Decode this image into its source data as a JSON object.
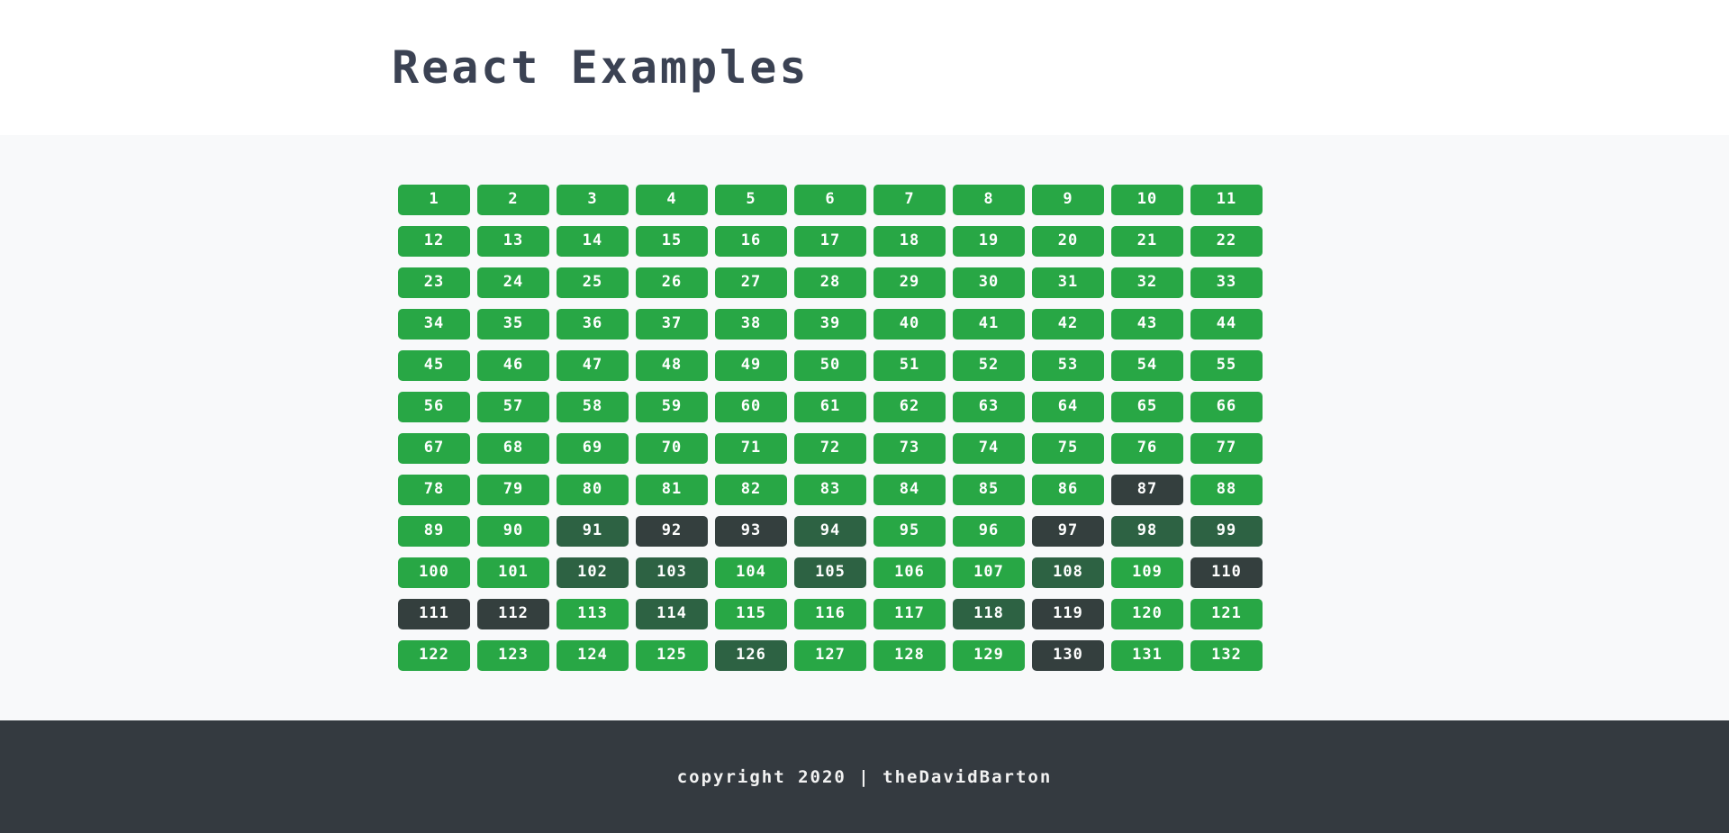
{
  "header": {
    "title": "React Examples"
  },
  "main": {
    "grid": {
      "columns": 11,
      "rows": 12,
      "total_cells": 132,
      "colors": {
        "on": "#28a745",
        "dim": "#2d6243",
        "off": "#343f3e",
        "label": "#ffffff"
      },
      "cells": [
        {
          "label": "1",
          "state": "on"
        },
        {
          "label": "2",
          "state": "on"
        },
        {
          "label": "3",
          "state": "on"
        },
        {
          "label": "4",
          "state": "on"
        },
        {
          "label": "5",
          "state": "on"
        },
        {
          "label": "6",
          "state": "on"
        },
        {
          "label": "7",
          "state": "on"
        },
        {
          "label": "8",
          "state": "on"
        },
        {
          "label": "9",
          "state": "on"
        },
        {
          "label": "10",
          "state": "on"
        },
        {
          "label": "11",
          "state": "on"
        },
        {
          "label": "12",
          "state": "on"
        },
        {
          "label": "13",
          "state": "on"
        },
        {
          "label": "14",
          "state": "on"
        },
        {
          "label": "15",
          "state": "on"
        },
        {
          "label": "16",
          "state": "on"
        },
        {
          "label": "17",
          "state": "on"
        },
        {
          "label": "18",
          "state": "on"
        },
        {
          "label": "19",
          "state": "on"
        },
        {
          "label": "20",
          "state": "on"
        },
        {
          "label": "21",
          "state": "on"
        },
        {
          "label": "22",
          "state": "on"
        },
        {
          "label": "23",
          "state": "on"
        },
        {
          "label": "24",
          "state": "on"
        },
        {
          "label": "25",
          "state": "on"
        },
        {
          "label": "26",
          "state": "on"
        },
        {
          "label": "27",
          "state": "on"
        },
        {
          "label": "28",
          "state": "on"
        },
        {
          "label": "29",
          "state": "on"
        },
        {
          "label": "30",
          "state": "on"
        },
        {
          "label": "31",
          "state": "on"
        },
        {
          "label": "32",
          "state": "on"
        },
        {
          "label": "33",
          "state": "on"
        },
        {
          "label": "34",
          "state": "on"
        },
        {
          "label": "35",
          "state": "on"
        },
        {
          "label": "36",
          "state": "on"
        },
        {
          "label": "37",
          "state": "on"
        },
        {
          "label": "38",
          "state": "on"
        },
        {
          "label": "39",
          "state": "on"
        },
        {
          "label": "40",
          "state": "on"
        },
        {
          "label": "41",
          "state": "on"
        },
        {
          "label": "42",
          "state": "on"
        },
        {
          "label": "43",
          "state": "on"
        },
        {
          "label": "44",
          "state": "on"
        },
        {
          "label": "45",
          "state": "on"
        },
        {
          "label": "46",
          "state": "on"
        },
        {
          "label": "47",
          "state": "on"
        },
        {
          "label": "48",
          "state": "on"
        },
        {
          "label": "49",
          "state": "on"
        },
        {
          "label": "50",
          "state": "on"
        },
        {
          "label": "51",
          "state": "on"
        },
        {
          "label": "52",
          "state": "on"
        },
        {
          "label": "53",
          "state": "on"
        },
        {
          "label": "54",
          "state": "on"
        },
        {
          "label": "55",
          "state": "on"
        },
        {
          "label": "56",
          "state": "on"
        },
        {
          "label": "57",
          "state": "on"
        },
        {
          "label": "58",
          "state": "on"
        },
        {
          "label": "59",
          "state": "on"
        },
        {
          "label": "60",
          "state": "on"
        },
        {
          "label": "61",
          "state": "on"
        },
        {
          "label": "62",
          "state": "on"
        },
        {
          "label": "63",
          "state": "on"
        },
        {
          "label": "64",
          "state": "on"
        },
        {
          "label": "65",
          "state": "on"
        },
        {
          "label": "66",
          "state": "on"
        },
        {
          "label": "67",
          "state": "on"
        },
        {
          "label": "68",
          "state": "on"
        },
        {
          "label": "69",
          "state": "on"
        },
        {
          "label": "70",
          "state": "on"
        },
        {
          "label": "71",
          "state": "on"
        },
        {
          "label": "72",
          "state": "on"
        },
        {
          "label": "73",
          "state": "on"
        },
        {
          "label": "74",
          "state": "on"
        },
        {
          "label": "75",
          "state": "on"
        },
        {
          "label": "76",
          "state": "on"
        },
        {
          "label": "77",
          "state": "on"
        },
        {
          "label": "78",
          "state": "on"
        },
        {
          "label": "79",
          "state": "on"
        },
        {
          "label": "80",
          "state": "on"
        },
        {
          "label": "81",
          "state": "on"
        },
        {
          "label": "82",
          "state": "on"
        },
        {
          "label": "83",
          "state": "on"
        },
        {
          "label": "84",
          "state": "on"
        },
        {
          "label": "85",
          "state": "on"
        },
        {
          "label": "86",
          "state": "on"
        },
        {
          "label": "87",
          "state": "off"
        },
        {
          "label": "88",
          "state": "on"
        },
        {
          "label": "89",
          "state": "on"
        },
        {
          "label": "90",
          "state": "on"
        },
        {
          "label": "91",
          "state": "dim"
        },
        {
          "label": "92",
          "state": "off"
        },
        {
          "label": "93",
          "state": "off"
        },
        {
          "label": "94",
          "state": "dim"
        },
        {
          "label": "95",
          "state": "on"
        },
        {
          "label": "96",
          "state": "on"
        },
        {
          "label": "97",
          "state": "off"
        },
        {
          "label": "98",
          "state": "dim"
        },
        {
          "label": "99",
          "state": "dim"
        },
        {
          "label": "100",
          "state": "on"
        },
        {
          "label": "101",
          "state": "on"
        },
        {
          "label": "102",
          "state": "dim"
        },
        {
          "label": "103",
          "state": "dim"
        },
        {
          "label": "104",
          "state": "on"
        },
        {
          "label": "105",
          "state": "dim"
        },
        {
          "label": "106",
          "state": "on"
        },
        {
          "label": "107",
          "state": "on"
        },
        {
          "label": "108",
          "state": "dim"
        },
        {
          "label": "109",
          "state": "on"
        },
        {
          "label": "110",
          "state": "off"
        },
        {
          "label": "111",
          "state": "off"
        },
        {
          "label": "112",
          "state": "off"
        },
        {
          "label": "113",
          "state": "on"
        },
        {
          "label": "114",
          "state": "dim"
        },
        {
          "label": "115",
          "state": "on"
        },
        {
          "label": "116",
          "state": "on"
        },
        {
          "label": "117",
          "state": "on"
        },
        {
          "label": "118",
          "state": "dim"
        },
        {
          "label": "119",
          "state": "off"
        },
        {
          "label": "120",
          "state": "on"
        },
        {
          "label": "121",
          "state": "on"
        },
        {
          "label": "122",
          "state": "on"
        },
        {
          "label": "123",
          "state": "on"
        },
        {
          "label": "124",
          "state": "on"
        },
        {
          "label": "125",
          "state": "on"
        },
        {
          "label": "126",
          "state": "dim"
        },
        {
          "label": "127",
          "state": "on"
        },
        {
          "label": "128",
          "state": "on"
        },
        {
          "label": "129",
          "state": "on"
        },
        {
          "label": "130",
          "state": "off"
        },
        {
          "label": "131",
          "state": "on"
        },
        {
          "label": "132",
          "state": "on"
        }
      ]
    }
  },
  "footer": {
    "copyright": "copyright 2020 | theDavidBarton"
  }
}
